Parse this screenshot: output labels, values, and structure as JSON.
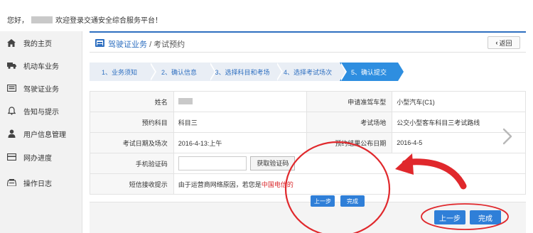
{
  "header": {
    "greeting_prefix": "您好，",
    "greeting_suffix": "欢迎登录交通安全综合服务平台！"
  },
  "sidebar": {
    "items": [
      {
        "label": "我的主页",
        "icon": "home-icon"
      },
      {
        "label": "机动车业务",
        "icon": "truck-icon"
      },
      {
        "label": "驾驶证业务",
        "icon": "id-card-icon"
      },
      {
        "label": "告知与提示",
        "icon": "bell-icon"
      },
      {
        "label": "用户信息管理",
        "icon": "user-icon"
      },
      {
        "label": "网办进度",
        "icon": "progress-icon"
      },
      {
        "label": "操作日志",
        "icon": "log-icon"
      }
    ]
  },
  "panel": {
    "title": "驾驶证业务",
    "subtitle": "/ 考试预约",
    "back_label": "返回"
  },
  "steps": [
    {
      "label": "1、业务须知"
    },
    {
      "label": "2、确认信息"
    },
    {
      "label": "3、选择科目和考场"
    },
    {
      "label": "4、选择考试场次"
    },
    {
      "label": "5、确认提交"
    }
  ],
  "form": {
    "name_label": "姓名",
    "license_type_label": "申请准驾车型",
    "license_type_value": "小型汽车(C1)",
    "subject_label": "预约科目",
    "subject_value": "科目三",
    "venue_label": "考试场地",
    "venue_value": "公交小型客车科目三考试路线",
    "exam_date_label": "考试日期及场次",
    "exam_date_value": "2016-4-13:上午",
    "result_date_label": "预约结果公布日期",
    "result_date_value": "2016-4-5",
    "sms_code_label": "手机验证码",
    "sms_code_value": "",
    "get_code_label": "获取验证码",
    "notice_label": "短信接收提示",
    "notice_text": "由于运营商网络原因，若您是",
    "notice_highlight": "中国电信的"
  },
  "actions": {
    "prev_label": "上一步",
    "done_label": "完成"
  },
  "colors": {
    "primary": "#2e6fc0",
    "button": "#2f7fd8",
    "annotation": "#e0282c"
  }
}
